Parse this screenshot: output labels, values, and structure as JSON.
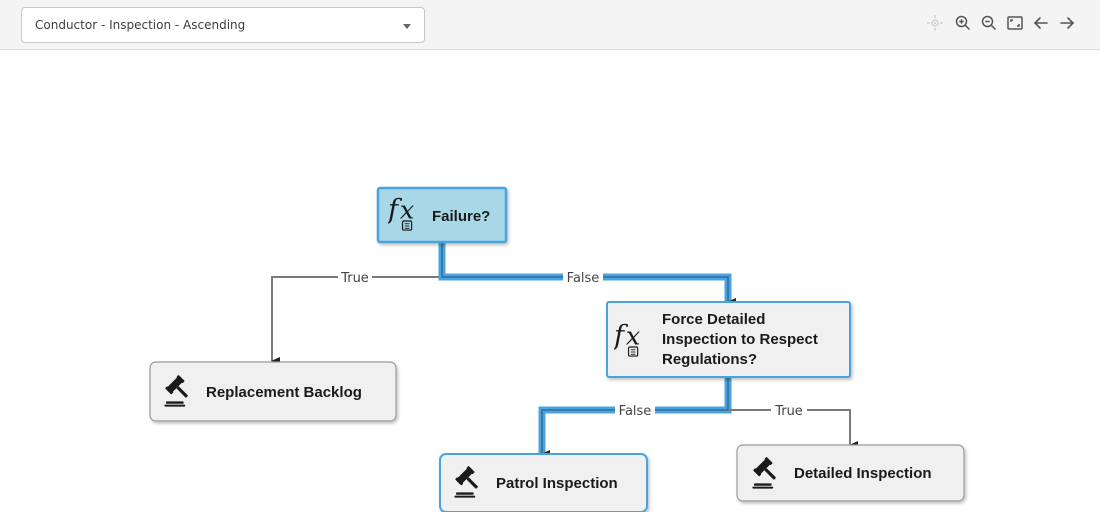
{
  "toolbar": {
    "selector": {
      "value": "Conductor - Inspection - Ascending"
    },
    "icons": [
      "center-icon",
      "zoom-in-icon",
      "zoom-out-icon",
      "fit-screen-icon",
      "back-arrow-icon",
      "forward-arrow-icon"
    ]
  },
  "diagram": {
    "nodes": {
      "failure": {
        "title": "Failure?",
        "icon": "function-icon",
        "state": "selected"
      },
      "force_detailed": {
        "title_lines": [
          "Force Detailed",
          "Inspection to Respect",
          "Regulations?"
        ],
        "icon": "function-icon",
        "state": "on-path"
      },
      "replacement_backlog": {
        "title": "Replacement Backlog",
        "icon": "gavel-icon"
      },
      "patrol_inspection": {
        "title": "Patrol Inspection",
        "icon": "gavel-icon",
        "state": "on-path"
      },
      "detailed_inspection": {
        "title": "Detailed Inspection",
        "icon": "gavel-icon"
      }
    },
    "edges": {
      "failure_true": {
        "label": "True"
      },
      "failure_false": {
        "label": "False"
      },
      "force_false": {
        "label": "False"
      },
      "force_true": {
        "label": "True"
      }
    }
  },
  "colors": {
    "highlight": "#4aa3df",
    "selected_fill": "#a8d8e8",
    "node_fill": "#f0f0f0",
    "edge": "#7a7a7a"
  }
}
